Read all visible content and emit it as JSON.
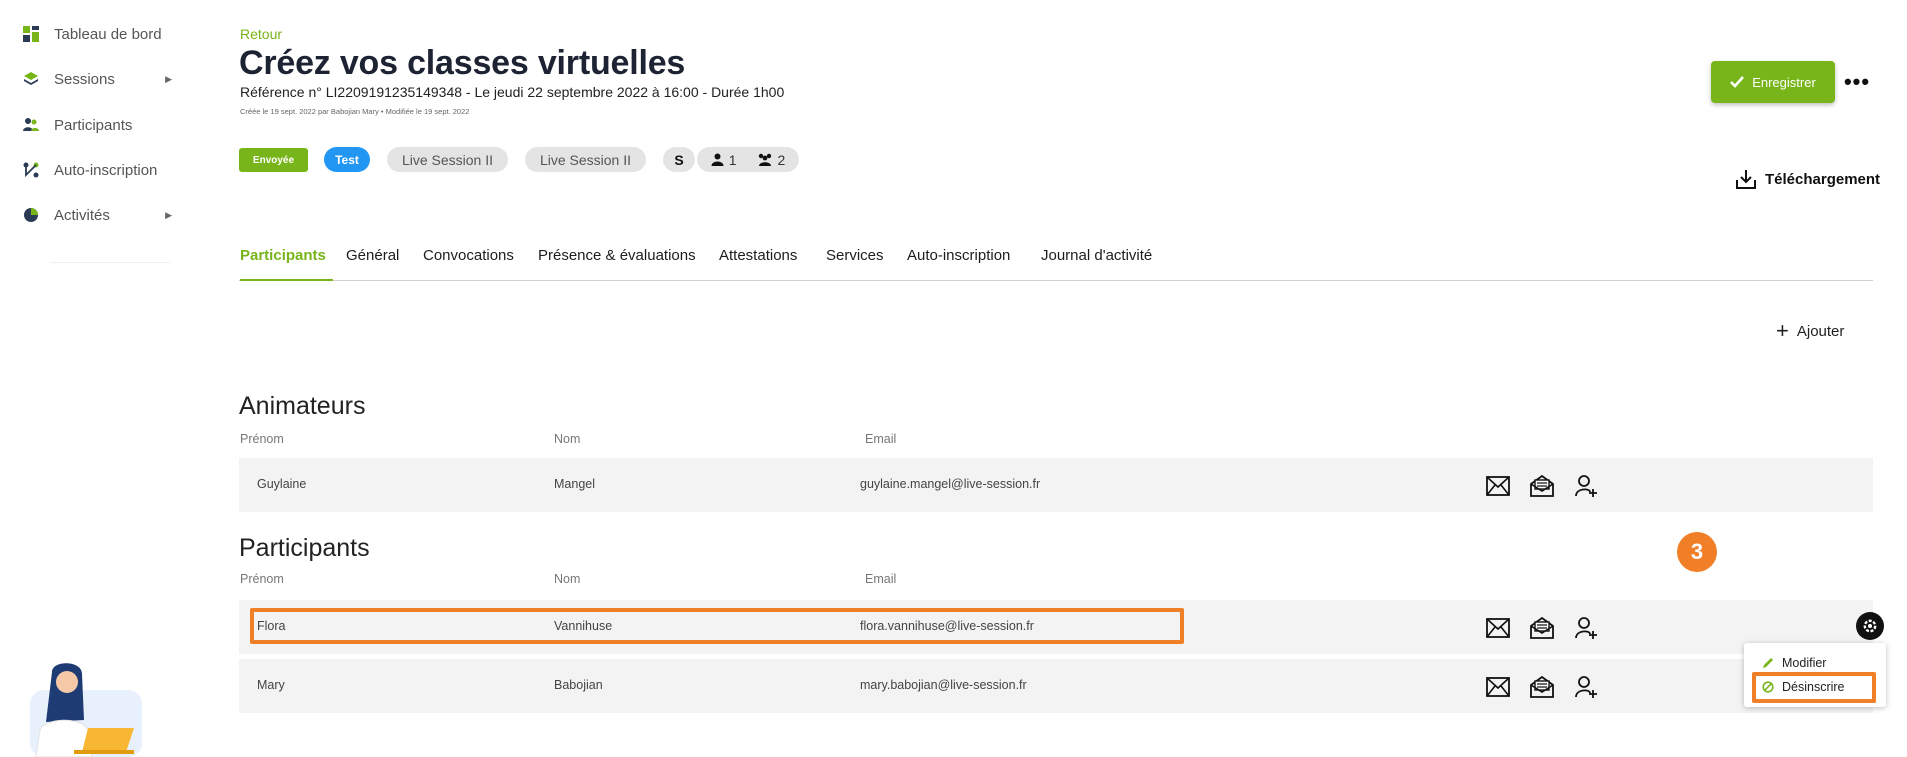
{
  "sidebar": {
    "items": [
      {
        "label": "Tableau de bord",
        "icon": "dashboard-icon",
        "has_arrow": false
      },
      {
        "label": "Sessions",
        "icon": "layers-icon",
        "has_arrow": true
      },
      {
        "label": "Participants",
        "icon": "users-icon",
        "has_arrow": false
      },
      {
        "label": "Auto-inscription",
        "icon": "flow-icon",
        "has_arrow": false
      },
      {
        "label": "Activités",
        "icon": "clock-icon",
        "has_arrow": true
      }
    ]
  },
  "header": {
    "back_label": "Retour",
    "title": "Créez vos classes virtuelles",
    "reference": "Référence n° LI2209191235149348 - Le jeudi 22 septembre 2022 à 16:00 - Durée 1h00",
    "created": "Créée le 19 sept. 2022 par Babojian Mary • Modifiée le 19 sept. 2022",
    "save_label": "Enregistrer",
    "more_label": "•••"
  },
  "badges": {
    "sent": "Envoyée",
    "test": "Test",
    "live1": "Live Session II",
    "live2": "Live Session II",
    "s": "S",
    "person_count": "1",
    "group_count": "2"
  },
  "download_label": "Téléchargement",
  "tabs": [
    {
      "label": "Participants",
      "active": true
    },
    {
      "label": "Général",
      "active": false
    },
    {
      "label": "Convocations",
      "active": false
    },
    {
      "label": "Présence & évaluations",
      "active": false
    },
    {
      "label": "Attestations",
      "active": false
    },
    {
      "label": "Services",
      "active": false
    },
    {
      "label": "Auto-inscription",
      "active": false
    },
    {
      "label": "Journal d'activité",
      "active": false
    }
  ],
  "add_label": "Ajouter",
  "animateurs": {
    "title": "Animateurs",
    "columns": [
      "Prénom",
      "Nom",
      "Email"
    ],
    "rows": [
      {
        "first": "Guylaine",
        "last": "Mangel",
        "email": "guylaine.mangel@live-session.fr"
      }
    ]
  },
  "participants": {
    "title": "Participants",
    "columns": [
      "Prénom",
      "Nom",
      "Email"
    ],
    "rows": [
      {
        "first": "Flora",
        "last": "Vannihuse",
        "email": "flora.vannihuse@live-session.fr"
      },
      {
        "first": "Mary",
        "last": "Babojian",
        "email": "mary.babojian@live-session.fr"
      }
    ]
  },
  "step_number": "3",
  "context_menu": {
    "edit_label": "Modifier",
    "unsubscribe_label": "Désinscrire"
  },
  "colors": {
    "brand_green": "#78b51a",
    "highlight_orange": "#f07f27",
    "test_blue": "#2196f3"
  }
}
